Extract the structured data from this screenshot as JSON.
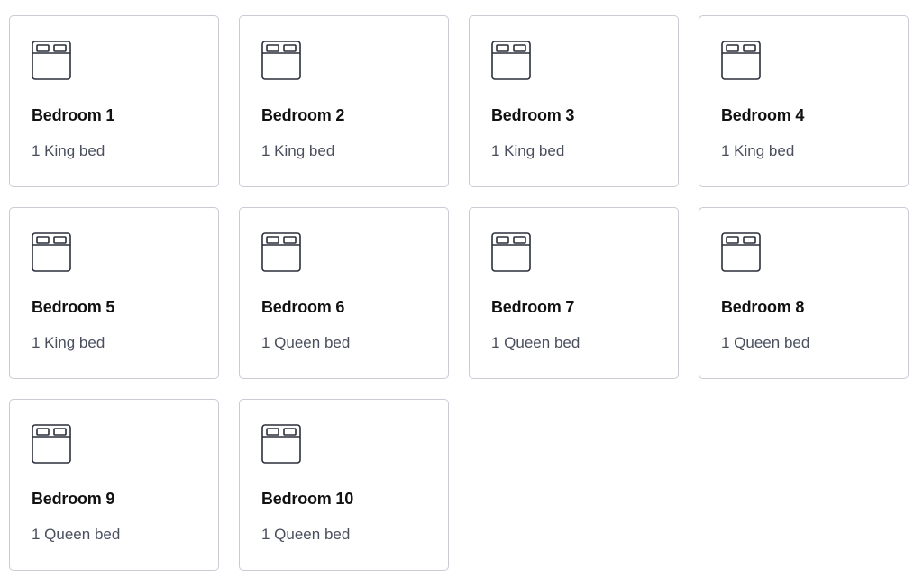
{
  "rooms": [
    {
      "name": "Bedroom 1",
      "beds": "1 King bed",
      "icon": "bed-icon"
    },
    {
      "name": "Bedroom 2",
      "beds": "1 King bed",
      "icon": "bed-icon"
    },
    {
      "name": "Bedroom 3",
      "beds": "1 King bed",
      "icon": "bed-icon"
    },
    {
      "name": "Bedroom 4",
      "beds": "1 King bed",
      "icon": "bed-icon"
    },
    {
      "name": "Bedroom 5",
      "beds": "1 King bed",
      "icon": "bed-icon"
    },
    {
      "name": "Bedroom 6",
      "beds": "1 Queen bed",
      "icon": "bed-icon"
    },
    {
      "name": "Bedroom 7",
      "beds": "1 Queen bed",
      "icon": "bed-icon"
    },
    {
      "name": "Bedroom 8",
      "beds": "1 Queen bed",
      "icon": "bed-icon"
    },
    {
      "name": "Bedroom 9",
      "beds": "1 Queen bed",
      "icon": "bed-icon"
    },
    {
      "name": "Bedroom 10",
      "beds": "1 Queen bed",
      "icon": "bed-icon"
    }
  ],
  "colors": {
    "card_border": "#c9cbd6",
    "title": "#111111",
    "subtitle": "#4a4f5e",
    "icon_stroke": "#2a2f3a"
  }
}
